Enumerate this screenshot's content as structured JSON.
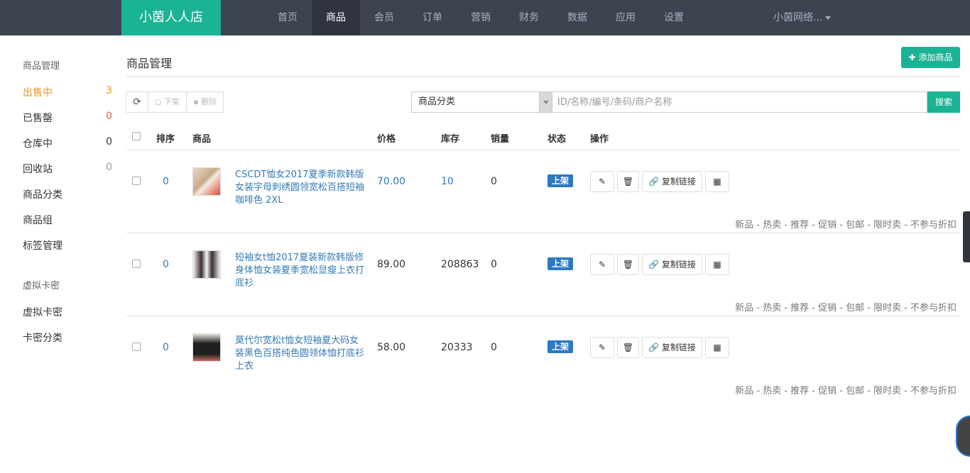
{
  "brand": "小茵人人店",
  "nav": [
    "首页",
    "商品",
    "会员",
    "订单",
    "营销",
    "财务",
    "数据",
    "应用",
    "设置"
  ],
  "nav_active": "商品",
  "user_menu": "小茵网络...",
  "sidebar": {
    "section1": "商品管理",
    "items1": [
      {
        "label": "出售中",
        "count": "3"
      },
      {
        "label": "已售罄",
        "count": "0"
      },
      {
        "label": "仓库中",
        "count": "0"
      },
      {
        "label": "回收站",
        "count": "0"
      },
      {
        "label": "商品分类"
      },
      {
        "label": "商品组"
      },
      {
        "label": "标签管理"
      }
    ],
    "section2": "虚拟卡密",
    "items2": [
      {
        "label": "虚拟卡密"
      },
      {
        "label": "卡密分类"
      }
    ]
  },
  "main": {
    "title": "商品管理",
    "add_button": "添加商品"
  },
  "toolbar": {
    "offshelf": "下架",
    "delete": "删除",
    "category_select": "商品分类",
    "search_placeholder": "ID/名称/编号/条码/商户名称",
    "search_button": "搜索"
  },
  "table": {
    "headers": [
      "排序",
      "商品",
      "价格",
      "库存",
      "销量",
      "状态",
      "操作"
    ],
    "rows": [
      {
        "sort": "0",
        "name": "CSCDT恤女2017夏季新款韩版女装字母刺绣圆领宽松百搭短袖咖啡色 2XL",
        "price": "70.00",
        "stock": "10",
        "sales": "0",
        "status": "上架",
        "copy_link": "复制链接",
        "tags": "新品 - 热卖 - 推荐 - 促销 - 包邮 - 限时卖 - 不参与折扣"
      },
      {
        "sort": "0",
        "name": "短袖女t恤2017夏装新款韩版修身体恤女装夏季宽松显瘦上衣打底衫",
        "price": "89.00",
        "stock": "208863",
        "sales": "0",
        "status": "上架",
        "copy_link": "复制链接",
        "tags": "新品 - 热卖 - 推荐 - 促销 - 包邮 - 限时卖 - 不参与折扣"
      },
      {
        "sort": "0",
        "name": "莫代尔宽松t恤女短袖夏大码女装黑色百搭纯色圆领体恤打底衫上衣",
        "price": "58.00",
        "stock": "20333",
        "sales": "0",
        "status": "上架",
        "copy_link": "复制链接",
        "tags": "新品 - 热卖 - 推荐 - 促销 - 包邮 - 限时卖 - 不参与折扣"
      }
    ]
  },
  "colors": {
    "brand": "#1ab394",
    "topbar": "#3d4350",
    "status": "#2a79c2",
    "active_side": "#e8981d"
  }
}
